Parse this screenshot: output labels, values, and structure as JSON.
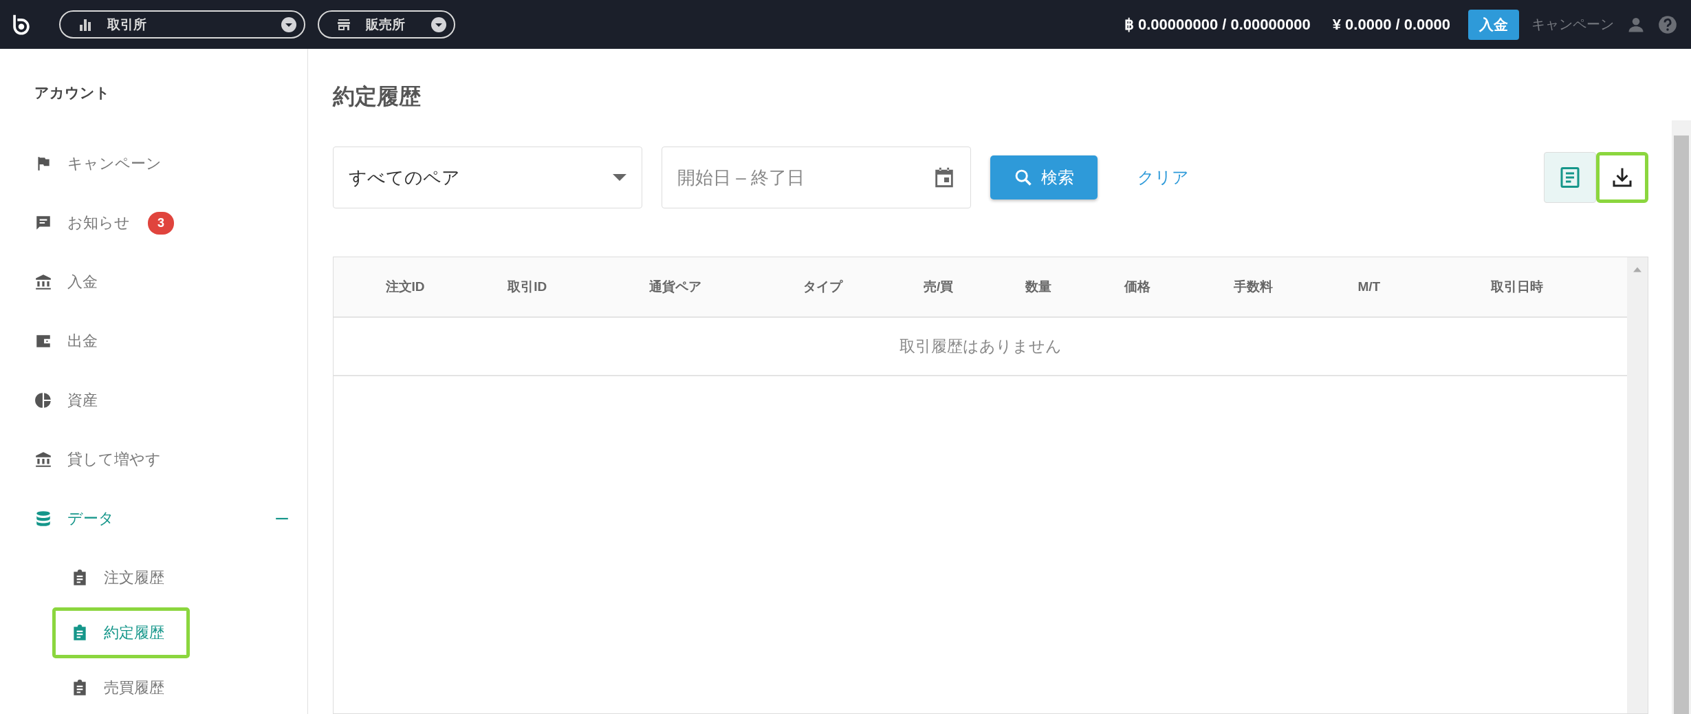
{
  "top_bar": {
    "market_selectors": [
      {
        "kind": "chart",
        "label": "取引所"
      },
      {
        "kind": "store",
        "label": "販売所"
      }
    ],
    "balances": [
      {
        "symbol": "฿",
        "value": "0.00000000 / 0.00000000"
      },
      {
        "symbol": "¥",
        "value": "0.0000 / 0.0000"
      }
    ],
    "deposit_button": "入金",
    "campaign_link": "キャンペーン"
  },
  "sidebar": {
    "heading": "アカウント",
    "items": [
      {
        "kind": "flag",
        "label": "キャンペーン",
        "expanded": false
      },
      {
        "kind": "chat",
        "label": "お知らせ",
        "badge": "3",
        "expanded": false
      },
      {
        "kind": "bank",
        "label": "入金",
        "expanded": false
      },
      {
        "kind": "wallet",
        "label": "出金",
        "expanded": false
      },
      {
        "kind": "pie",
        "label": "資産",
        "expanded": false
      },
      {
        "kind": "bank",
        "label": "貸して増やす",
        "expanded": false
      },
      {
        "kind": "database",
        "label": "データ",
        "expanded": true,
        "children": [
          {
            "label": "注文履歴",
            "selected": false,
            "highlighted": false
          },
          {
            "label": "約定履歴",
            "selected": true,
            "highlighted": true
          },
          {
            "label": "売買履歴",
            "selected": false,
            "highlighted": false
          }
        ]
      }
    ]
  },
  "main": {
    "title": "約定履歴",
    "pair_select": "すべてのペア",
    "date_range": {
      "placeholder": "開始日 – 終了日"
    },
    "search_button": "検索",
    "clear_link": "クリア",
    "view_buttons": [
      {
        "kind": "list",
        "selected": true,
        "highlighted": false
      },
      {
        "kind": "download",
        "selected": false,
        "highlighted": true
      }
    ],
    "table": {
      "columns": [
        "注文ID",
        "取引ID",
        "通貨ペア",
        "タイプ",
        "売/買",
        "数量",
        "価格",
        "手数料",
        "M/T",
        "取引日時"
      ],
      "empty_message": "取引履歴はありません"
    }
  }
}
